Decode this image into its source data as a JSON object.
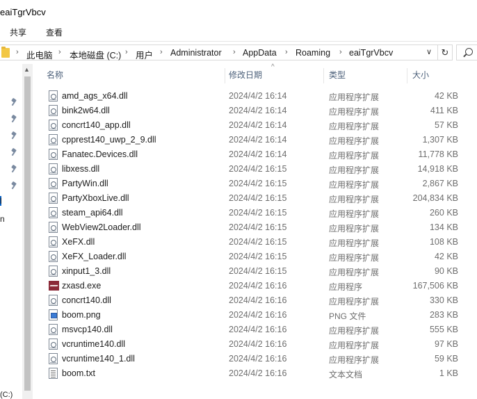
{
  "window": {
    "title": "eaiTgrVbcv"
  },
  "ribbon": {
    "tabs": [
      "共享",
      "查看"
    ]
  },
  "address": {
    "crumbs": [
      "此电脑",
      "本地磁盘 (C:)",
      "用户",
      "Administrator",
      "AppData",
      "Roaming",
      "eaiTgrVbcv"
    ],
    "separator": "›",
    "dropdown": "∨",
    "refresh": "↻"
  },
  "navpane": {
    "fragments": [
      "l",
      "n"
    ],
    "status": "(C:)"
  },
  "columns": {
    "name": "名称",
    "date": "修改日期",
    "type": "类型",
    "size": "大小",
    "sort_indicator": "^"
  },
  "files": [
    {
      "name": "amd_ags_x64.dll",
      "date": "2024/4/2 16:14",
      "type": "应用程序扩展",
      "size": "42 KB",
      "icon": "dll-icon"
    },
    {
      "name": "bink2w64.dll",
      "date": "2024/4/2 16:14",
      "type": "应用程序扩展",
      "size": "411 KB",
      "icon": "dll-icon"
    },
    {
      "name": "concrt140_app.dll",
      "date": "2024/4/2 16:14",
      "type": "应用程序扩展",
      "size": "57 KB",
      "icon": "dll-icon"
    },
    {
      "name": "cpprest140_uwp_2_9.dll",
      "date": "2024/4/2 16:14",
      "type": "应用程序扩展",
      "size": "1,307 KB",
      "icon": "dll-icon"
    },
    {
      "name": "Fanatec.Devices.dll",
      "date": "2024/4/2 16:14",
      "type": "应用程序扩展",
      "size": "11,778 KB",
      "icon": "dll-icon"
    },
    {
      "name": "libxess.dll",
      "date": "2024/4/2 16:15",
      "type": "应用程序扩展",
      "size": "14,918 KB",
      "icon": "dll-icon"
    },
    {
      "name": "PartyWin.dll",
      "date": "2024/4/2 16:15",
      "type": "应用程序扩展",
      "size": "2,867 KB",
      "icon": "dll-icon"
    },
    {
      "name": "PartyXboxLive.dll",
      "date": "2024/4/2 16:15",
      "type": "应用程序扩展",
      "size": "204,834 KB",
      "icon": "dll-icon"
    },
    {
      "name": "steam_api64.dll",
      "date": "2024/4/2 16:15",
      "type": "应用程序扩展",
      "size": "260 KB",
      "icon": "dll-icon"
    },
    {
      "name": "WebView2Loader.dll",
      "date": "2024/4/2 16:15",
      "type": "应用程序扩展",
      "size": "134 KB",
      "icon": "dll-icon"
    },
    {
      "name": "XeFX.dll",
      "date": "2024/4/2 16:15",
      "type": "应用程序扩展",
      "size": "108 KB",
      "icon": "dll-icon"
    },
    {
      "name": "XeFX_Loader.dll",
      "date": "2024/4/2 16:15",
      "type": "应用程序扩展",
      "size": "42 KB",
      "icon": "dll-icon"
    },
    {
      "name": "xinput1_3.dll",
      "date": "2024/4/2 16:15",
      "type": "应用程序扩展",
      "size": "90 KB",
      "icon": "dll-icon"
    },
    {
      "name": "zxasd.exe",
      "date": "2024/4/2 16:16",
      "type": "应用程序",
      "size": "167,506 KB",
      "icon": "exe-icon"
    },
    {
      "name": "concrt140.dll",
      "date": "2024/4/2 16:16",
      "type": "应用程序扩展",
      "size": "330 KB",
      "icon": "dll-icon"
    },
    {
      "name": "boom.png",
      "date": "2024/4/2 16:16",
      "type": "PNG 文件",
      "size": "283 KB",
      "icon": "png-icon"
    },
    {
      "name": "msvcp140.dll",
      "date": "2024/4/2 16:16",
      "type": "应用程序扩展",
      "size": "555 KB",
      "icon": "dll-icon"
    },
    {
      "name": "vcruntime140.dll",
      "date": "2024/4/2 16:16",
      "type": "应用程序扩展",
      "size": "97 KB",
      "icon": "dll-icon"
    },
    {
      "name": "vcruntime140_1.dll",
      "date": "2024/4/2 16:16",
      "type": "应用程序扩展",
      "size": "59 KB",
      "icon": "dll-icon"
    },
    {
      "name": "boom.txt",
      "date": "2024/4/2 16:16",
      "type": "文本文档",
      "size": "1 KB",
      "icon": "txt-icon"
    }
  ]
}
